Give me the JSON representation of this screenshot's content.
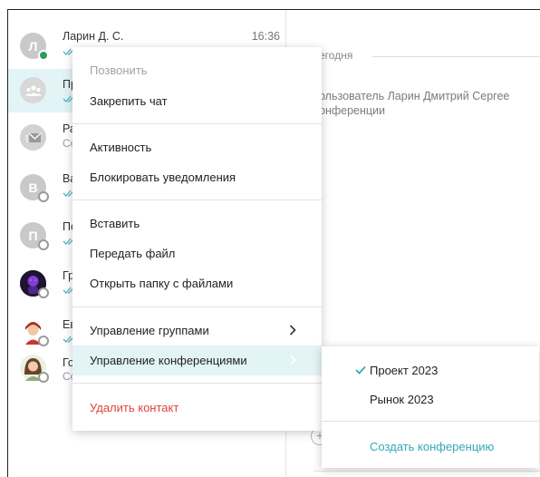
{
  "chat_list": [
    {
      "name": "Ларин Д. С.",
      "time": "16:36",
      "avatar_letter": "Л",
      "status": "online",
      "avatar_icon": "letter",
      "subtitle_icon": "double-check-icon"
    },
    {
      "name": "Пр",
      "avatar_icon": "group-icon",
      "active": true,
      "subtitle_icon": "double-check-icon"
    },
    {
      "name": "Ра",
      "subtitle": "Со",
      "avatar_icon": "mail-icon"
    },
    {
      "name": "Ва",
      "avatar_letter": "В",
      "status": "offline",
      "avatar_icon": "letter",
      "subtitle_icon": "double-check-icon"
    },
    {
      "name": "По",
      "avatar_letter": "П",
      "status": "offline",
      "avatar_icon": "letter",
      "subtitle_icon": "double-check-icon"
    },
    {
      "name": "Гр",
      "avatar_icon": "photo-avatar",
      "status": "offline",
      "subtitle_icon": "double-check-icon"
    },
    {
      "name": "Ев",
      "avatar_icon": "photo-avatar",
      "status": "offline",
      "subtitle_icon": "double-check-icon"
    },
    {
      "name": "Го",
      "subtitle": "Со",
      "avatar_icon": "photo-avatar",
      "status": "offline"
    }
  ],
  "conversation": {
    "date_divider": "егодня",
    "system_message_line1": "ользователь Ларин Дмитрий Сергее",
    "system_message_line2": "онференции"
  },
  "context_menu": {
    "call": "Позвонить",
    "pin_chat": "Закрепить чат",
    "activity": "Активность",
    "block_notifications": "Блокировать уведомления",
    "paste": "Вставить",
    "send_file": "Передать файл",
    "open_files_folder": "Открыть папку с файлами",
    "manage_groups": "Управление группами",
    "manage_conferences": "Управление конференциями",
    "delete_contact": "Удалить контакт"
  },
  "submenu": {
    "items": [
      {
        "label": "Проект 2023",
        "checked": true
      },
      {
        "label": "Рынок 2023",
        "checked": false
      }
    ],
    "create_conference": "Создать конференцию"
  },
  "colors": {
    "accent": "#36a8b8",
    "active_row": "#e3f4f6",
    "danger": "#e2423b",
    "online": "#2e9d5c",
    "muted": "#a3a3a3"
  }
}
